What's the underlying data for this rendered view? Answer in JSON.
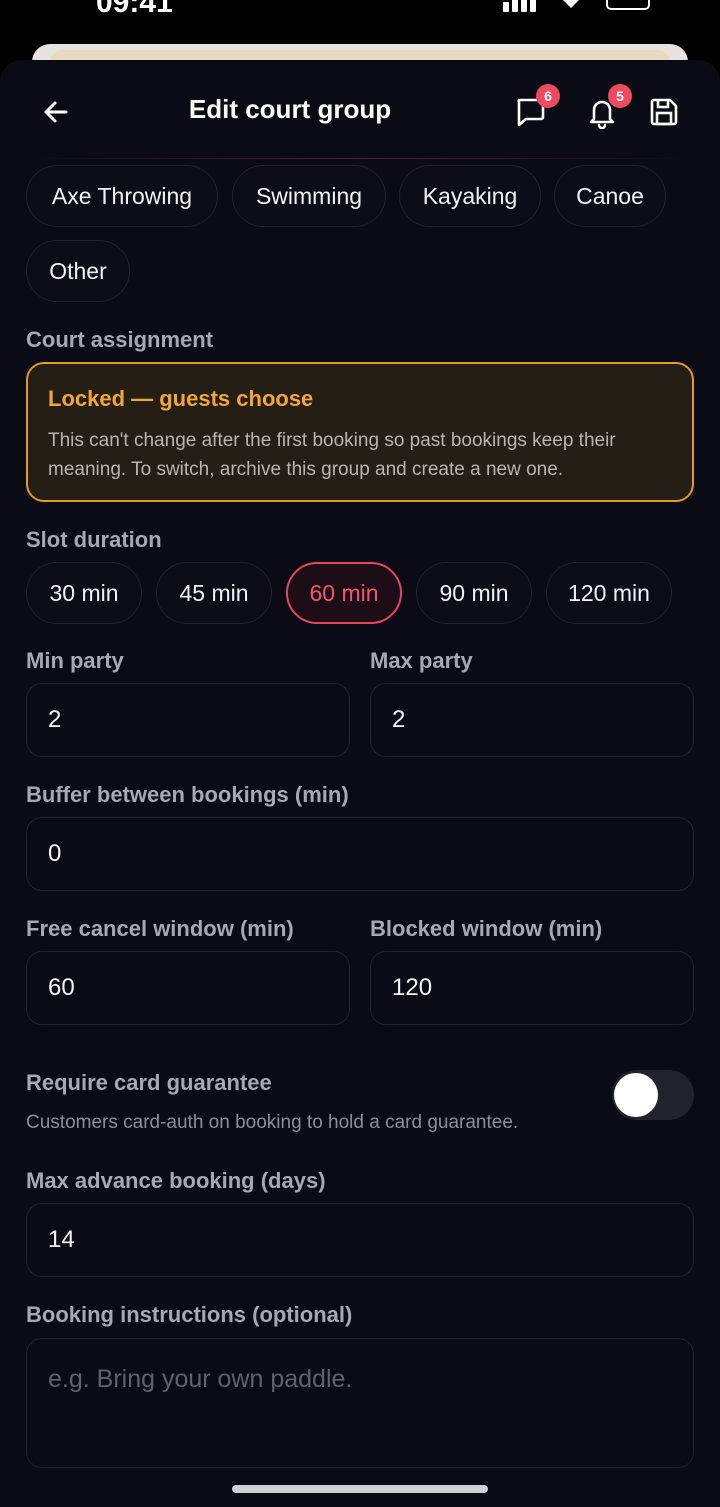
{
  "status_bar": {
    "time": "09:41"
  },
  "header": {
    "title": "Edit court group",
    "messages_badge": "6",
    "notifications_badge": "5"
  },
  "categories": [
    "Axe Throwing",
    "Swimming",
    "Kayaking",
    "Canoe",
    "Other"
  ],
  "court_assignment": {
    "label": "Court assignment",
    "title": "Locked — guests choose",
    "description": "This can't change after the first booking so past bookings keep their meaning. To switch, archive this group and create a new one."
  },
  "slot_duration": {
    "label": "Slot duration",
    "options": [
      "30 min",
      "45 min",
      "60 min",
      "90 min",
      "120 min"
    ],
    "selected": "60 min"
  },
  "min_party": {
    "label": "Min party",
    "value": "2"
  },
  "max_party": {
    "label": "Max party",
    "value": "2"
  },
  "buffer": {
    "label": "Buffer between bookings (min)",
    "value": "0"
  },
  "free_cancel": {
    "label": "Free cancel window (min)",
    "value": "60"
  },
  "blocked_window": {
    "label": "Blocked window (min)",
    "value": "120"
  },
  "card_guarantee": {
    "label": "Require card guarantee",
    "description": "Customers card-auth on booking to hold a card guarantee.",
    "enabled": false
  },
  "max_advance": {
    "label": "Max advance booking (days)",
    "value": "14"
  },
  "instructions": {
    "label": "Booking instructions (optional)",
    "placeholder": "e.g. Bring your own paddle."
  },
  "colors": {
    "accent": "#e8465e",
    "warning": "#e39a27",
    "background": "#0b0b16"
  }
}
